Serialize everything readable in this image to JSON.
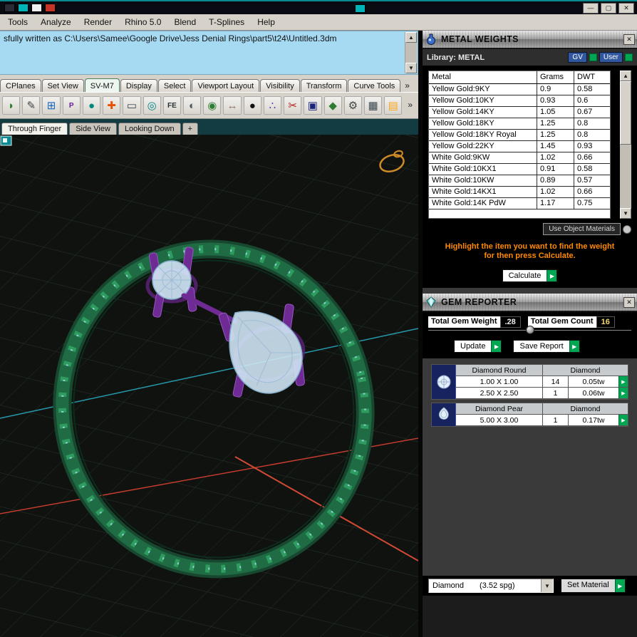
{
  "colors": {
    "green": "#00a651",
    "orange": "#ff8a00"
  },
  "glyphs": {
    "up": "▲",
    "down": "▼",
    "right": "▶",
    "chevron": "»",
    "close": "✕",
    "minimize": "—",
    "maximize": "▢",
    "dropdown": "▼",
    "plus": "+"
  },
  "menubar": {
    "items": [
      "Tools",
      "Analyze",
      "Render",
      "Rhino 5.0",
      "Blend",
      "T-Splines",
      "Help"
    ]
  },
  "command": {
    "history": "sfully written as C:\\Users\\Samee\\Google Drive\\Jess Denial Rings\\part5\\t24\\Untitled.3dm"
  },
  "tabs": {
    "items": [
      "CPlanes",
      "Set View",
      "SV-M7",
      "Display",
      "Select",
      "Viewport Layout",
      "Visibility",
      "Transform",
      "Curve Tools"
    ]
  },
  "toolbar": {
    "icons": [
      {
        "name": "brush-icon",
        "glyph": "◗"
      },
      {
        "name": "pencil-icon",
        "glyph": "✎"
      },
      {
        "name": "snap-grid-icon",
        "glyph": "⊞"
      },
      {
        "name": "control-points-icon",
        "glyph": "P"
      },
      {
        "name": "sphere-icon",
        "glyph": "●"
      },
      {
        "name": "gumball-icon",
        "glyph": "✚"
      },
      {
        "name": "display-mode-icon",
        "glyph": "▭"
      },
      {
        "name": "rotate-view-icon",
        "glyph": "◎"
      },
      {
        "name": "fe-edit-icon",
        "glyph": "FE"
      },
      {
        "name": "shade-mode-icon",
        "glyph": "◐"
      },
      {
        "name": "orbit-icon",
        "glyph": "◉"
      },
      {
        "name": "pan-icon",
        "glyph": "↔"
      },
      {
        "name": "render-sphere-icon",
        "glyph": "●"
      },
      {
        "name": "point-cloud-icon",
        "glyph": "∴"
      },
      {
        "name": "cut-icon",
        "glyph": "✂"
      },
      {
        "name": "save-icon",
        "glyph": "▣"
      },
      {
        "name": "polysurface-icon",
        "glyph": "◆"
      },
      {
        "name": "gear-icon",
        "glyph": "⚙"
      },
      {
        "name": "layout-icon",
        "glyph": "▦"
      },
      {
        "name": "layers-icon",
        "glyph": "▤"
      }
    ]
  },
  "viewport": {
    "tabs": [
      "Through Finger",
      "Side View",
      "Looking Down"
    ]
  },
  "metal_weights": {
    "title": "METAL WEIGHTS",
    "library_label": "Library: METAL",
    "gv_button": "GV",
    "user_button": "User",
    "columns": [
      "Metal",
      "Grams",
      "DWT"
    ],
    "rows": [
      {
        "metal": "Yellow Gold:9KY",
        "grams": "0.9",
        "dwt": "0.58"
      },
      {
        "metal": "Yellow Gold:10KY",
        "grams": "0.93",
        "dwt": "0.6"
      },
      {
        "metal": "Yellow Gold:14KY",
        "grams": "1.05",
        "dwt": "0.67"
      },
      {
        "metal": "Yellow Gold:18KY",
        "grams": "1.25",
        "dwt": "0.8"
      },
      {
        "metal": "Yellow Gold:18KY Royal",
        "grams": "1.25",
        "dwt": "0.8"
      },
      {
        "metal": "Yellow Gold:22KY",
        "grams": "1.45",
        "dwt": "0.93"
      },
      {
        "metal": "White Gold:9KW",
        "grams": "1.02",
        "dwt": "0.66"
      },
      {
        "metal": "White Gold:10KX1",
        "grams": "0.91",
        "dwt": "0.58"
      },
      {
        "metal": "White Gold:10KW",
        "grams": "0.89",
        "dwt": "0.57"
      },
      {
        "metal": "White Gold:14KX1",
        "grams": "1.02",
        "dwt": "0.66"
      },
      {
        "metal": "White Gold:14K PdW",
        "grams": "1.17",
        "dwt": "0.75"
      }
    ],
    "use_object_materials": "Use Object Materials",
    "instruction_line1": "Highlight the item you want to find the weight",
    "instruction_line2": "for then press Calculate.",
    "calculate_button": "Calculate"
  },
  "gem_reporter": {
    "title": "GEM REPORTER",
    "total_weight_label": "Total Gem Weight",
    "total_weight_value": ".28",
    "total_count_label": "Total Gem Count",
    "total_count_value": "16",
    "update_button": "Update",
    "save_report_button": "Save Report",
    "groups": [
      {
        "name": "Diamond Round",
        "material": "Diamond",
        "rows": [
          {
            "size": "1.00 X 1.00",
            "count": "14",
            "weight": "0.05tw"
          },
          {
            "size": "2.50 X 2.50",
            "count": "1",
            "weight": "0.06tw"
          }
        ]
      },
      {
        "name": "Diamond Pear",
        "material": "Diamond",
        "rows": [
          {
            "size": "5.00 X 3.00",
            "count": "1",
            "weight": "0.17tw"
          }
        ]
      }
    ],
    "material_dropdown": "Diamond",
    "material_spg": "(3.52 spg)",
    "set_material_button": "Set Material"
  }
}
